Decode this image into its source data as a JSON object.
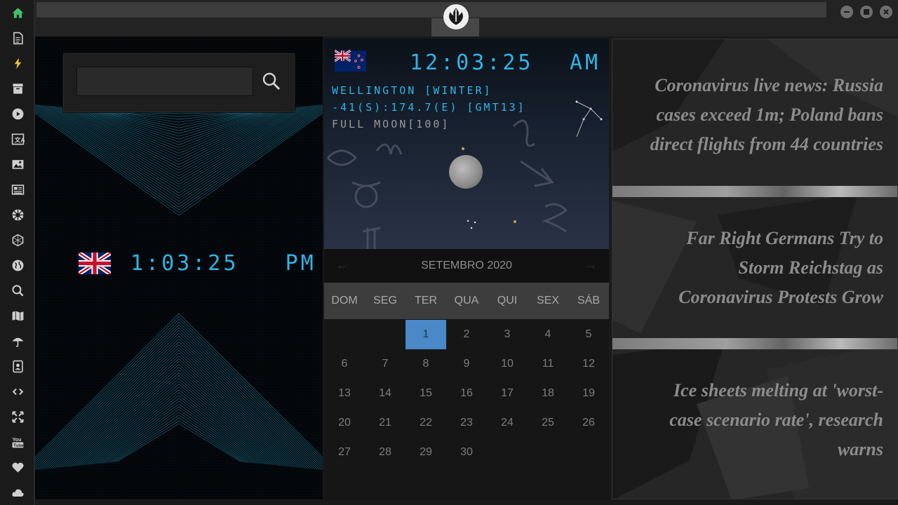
{
  "sidebar": {
    "items": [
      {
        "icon": "home-icon",
        "label": "Home"
      },
      {
        "icon": "document-icon",
        "label": "Documents"
      },
      {
        "icon": "lightning-icon",
        "label": "Quick"
      },
      {
        "icon": "archive-icon",
        "label": "Archive"
      },
      {
        "icon": "play-icon",
        "label": "Media"
      },
      {
        "icon": "translate-icon",
        "label": "Translate"
      },
      {
        "icon": "image-icon",
        "label": "Images"
      },
      {
        "icon": "newspaper-icon",
        "label": "News"
      },
      {
        "icon": "empire-icon",
        "label": "Empire"
      },
      {
        "icon": "hexagon-icon",
        "label": "Network"
      },
      {
        "icon": "globe-icon",
        "label": "World"
      },
      {
        "icon": "search-icon",
        "label": "Search"
      },
      {
        "icon": "map-icon",
        "label": "Map"
      },
      {
        "icon": "umbrella-icon",
        "label": "Weather"
      },
      {
        "icon": "contacts-icon",
        "label": "Contacts"
      },
      {
        "icon": "link-icon",
        "label": "Links"
      },
      {
        "icon": "expand-icon",
        "label": "Fullscreen"
      },
      {
        "icon": "youtube-icon",
        "label": "YouTube"
      },
      {
        "icon": "heart-icon",
        "label": "Favorites"
      },
      {
        "icon": "cloud-icon",
        "label": "Cloud"
      }
    ]
  },
  "colors": {
    "accent": "#2fb4e6",
    "home_icon": "#3ec16b",
    "lightning_icon": "#f1c232",
    "calendar_selected": "#4a88c7"
  },
  "search": {
    "placeholder": "",
    "value": ""
  },
  "local_clock": {
    "time": "1:03:25",
    "ampm": "PM",
    "flag": "UK"
  },
  "remote_clock": {
    "time": "12:03:25",
    "ampm": "AM",
    "flag": "NZ",
    "city": "WELLINGTON [WINTER]",
    "coords": "-41(S):174.7(E) [GMT13]",
    "moon": "FULL MOON[100]"
  },
  "calendar": {
    "title": "SETEMBRO 2020",
    "prev": "←",
    "next": "→",
    "days_of_week": [
      "DOM",
      "SEG",
      "TER",
      "QUA",
      "QUI",
      "SEX",
      "SÁB"
    ],
    "first_weekday": 2,
    "days_in_month": 30,
    "selected_day": 1
  },
  "news": [
    {
      "lines": [
        "Coronavirus live news: Russia",
        "cases exceed 1m; Poland bans",
        "direct flights from 44 countries"
      ]
    },
    {
      "lines": [
        "Far Right Germans Try to",
        "Storm Reichstag as",
        "Coronavirus Protests Grow"
      ]
    },
    {
      "lines": [
        "Ice sheets melting at 'worst-",
        "case scenario rate', research",
        "warns"
      ]
    }
  ]
}
